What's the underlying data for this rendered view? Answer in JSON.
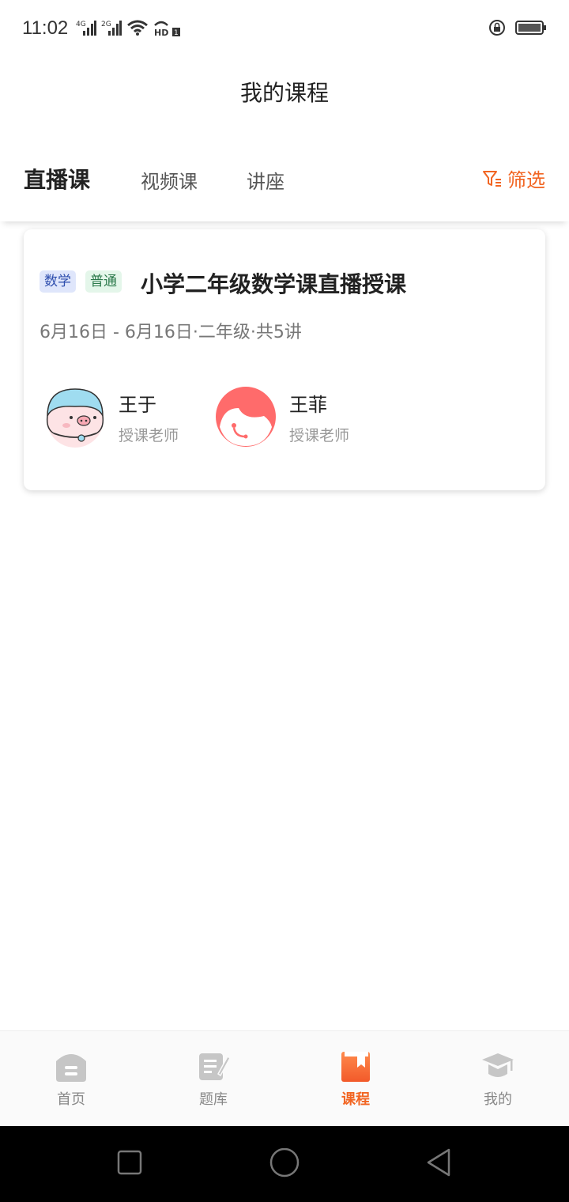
{
  "status_bar": {
    "time": "11:02",
    "network_1": "4G",
    "network_2": "2G",
    "hd_label": "HD",
    "hd_number": "1"
  },
  "header": {
    "title": "我的课程"
  },
  "tabs": [
    {
      "label": "直播课",
      "active": true
    },
    {
      "label": "视频课",
      "active": false
    },
    {
      "label": "讲座",
      "active": false
    }
  ],
  "filter": {
    "label": "筛选",
    "icon": "filter-icon",
    "color": "#f26522"
  },
  "course": {
    "tags": [
      {
        "label": "数学"
      },
      {
        "label": "普通"
      }
    ],
    "title": "小学二年级数学课直播授课",
    "meta": "6月16日 - 6月16日·二年级·共5讲",
    "teachers": [
      {
        "name": "王于",
        "role": "授课老师",
        "avatar": "pig-avatar"
      },
      {
        "name": "王菲",
        "role": "授课老师",
        "avatar": "girl-avatar"
      }
    ]
  },
  "bottom_nav": [
    {
      "label": "首页",
      "icon": "home-icon",
      "active": false
    },
    {
      "label": "题库",
      "icon": "question-bank-icon",
      "active": false
    },
    {
      "label": "课程",
      "icon": "course-icon",
      "active": true
    },
    {
      "label": "我的",
      "icon": "graduation-cap-icon",
      "active": false
    }
  ],
  "colors": {
    "accent": "#f26522",
    "muted": "#888888"
  }
}
